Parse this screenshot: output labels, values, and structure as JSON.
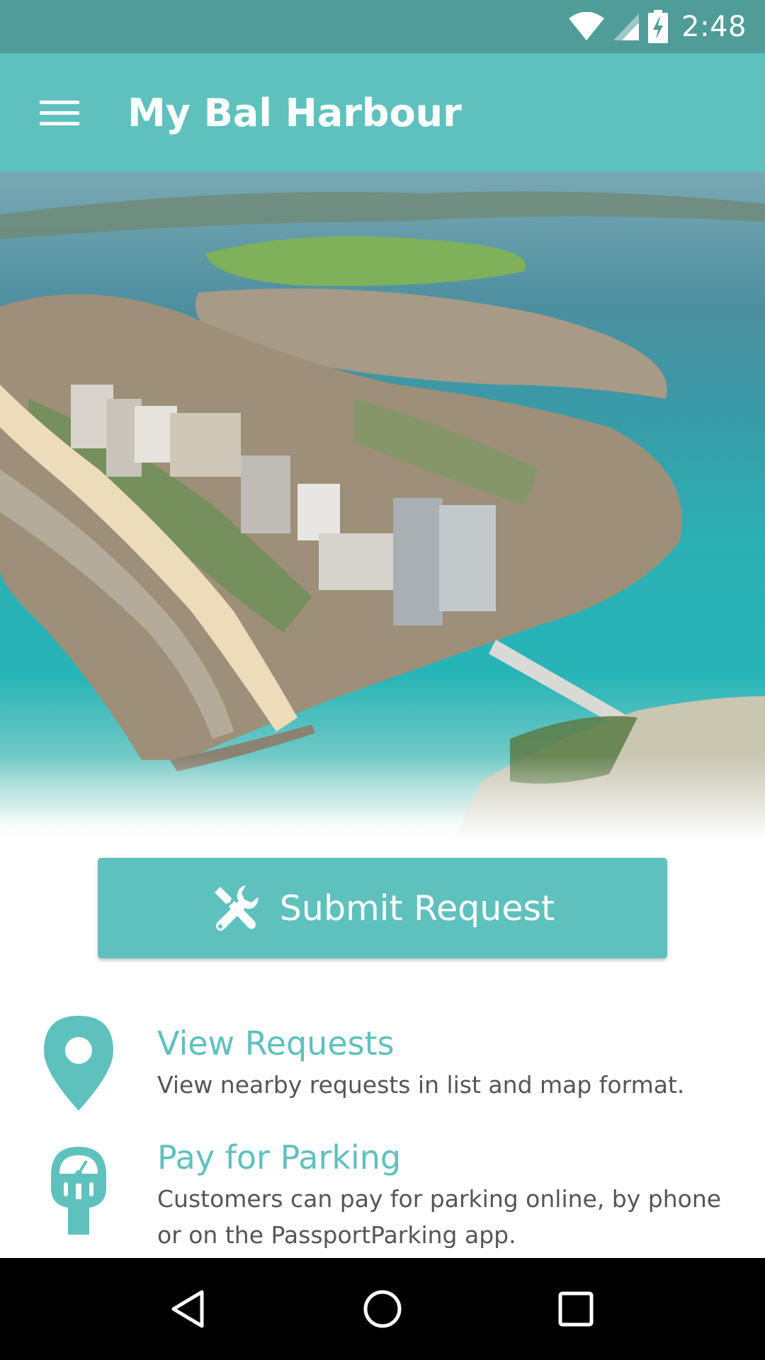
{
  "status_bar": {
    "time": "2:48",
    "icons": [
      "wifi-icon",
      "signal-icon",
      "battery-charging-icon"
    ]
  },
  "app_bar": {
    "title": "My Bal Harbour",
    "menu_icon": "hamburger-menu-icon"
  },
  "hero": {
    "image_name": "aerial-coastline-photo"
  },
  "submit_button": {
    "label": "Submit Request",
    "icon": "wrench-screwdriver-icon"
  },
  "items": [
    {
      "title": "View Requests",
      "description": "View nearby requests in list and map format.",
      "icon": "map-pin-icon"
    },
    {
      "title": "Pay for Parking",
      "description": "Customers can pay for parking online, by phone or on the PassportParking app.",
      "icon": "parking-meter-icon"
    }
  ],
  "nav_bar": {
    "buttons": [
      "back-icon",
      "home-icon",
      "recents-icon"
    ]
  },
  "colors": {
    "accent": "#5fc1bd",
    "status_bar": "#4f9c98",
    "text_secondary": "#555555",
    "nav_bar": "#000000"
  }
}
